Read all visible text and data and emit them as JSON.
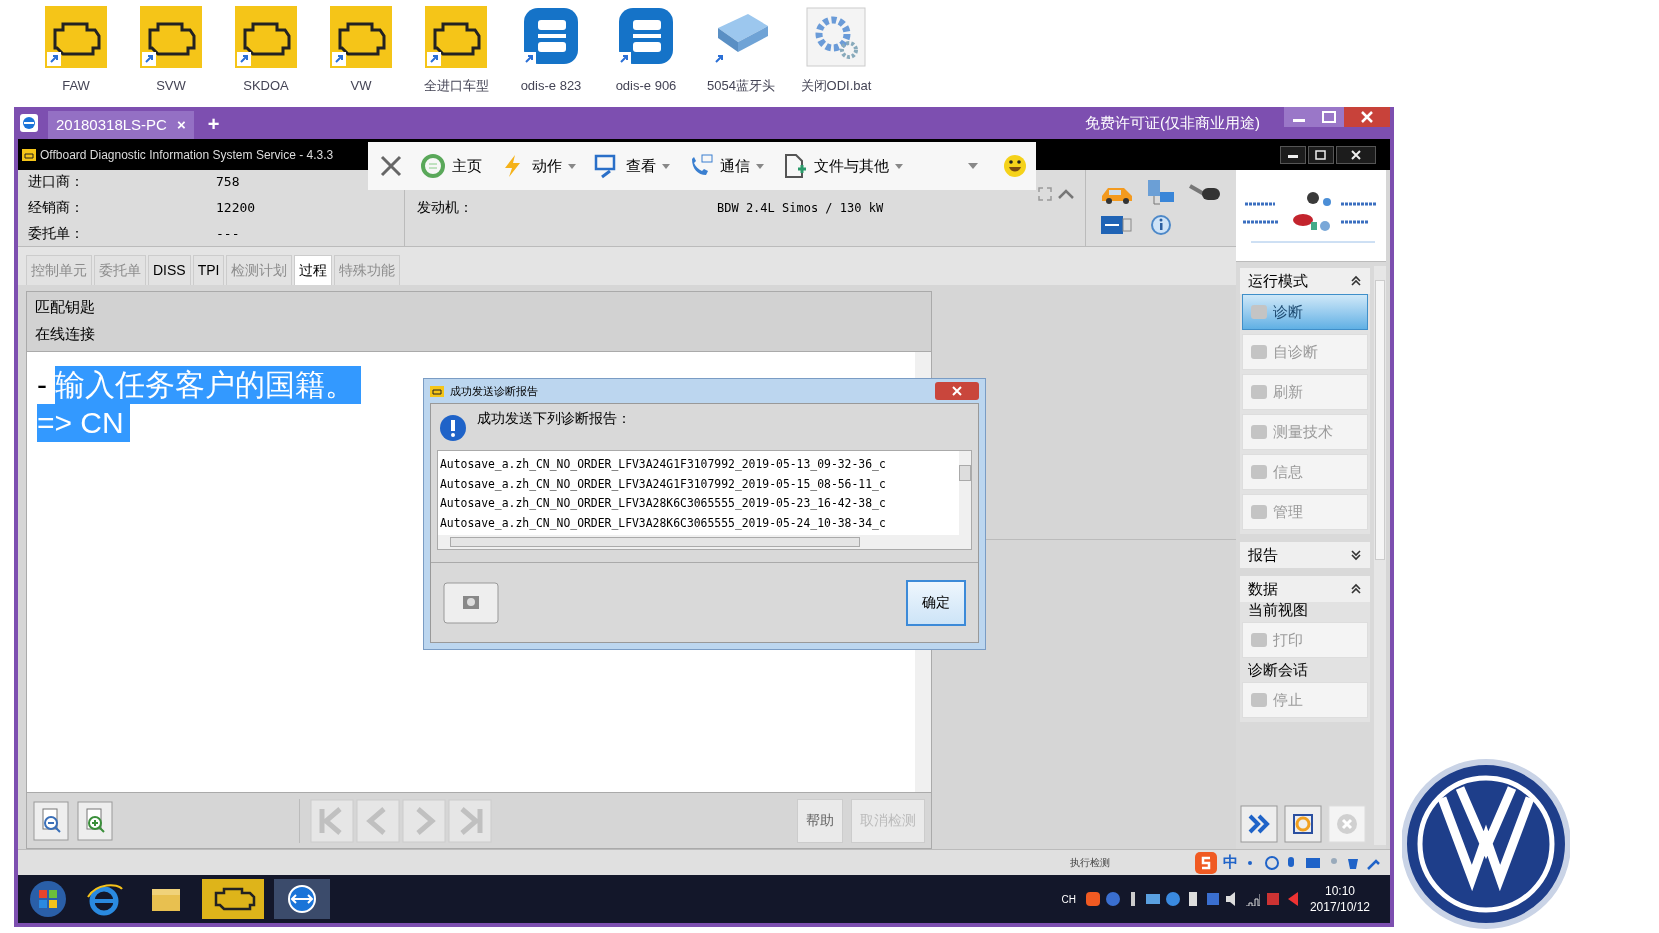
{
  "desktop_icons": [
    {
      "label": "FAW",
      "kind": "engine"
    },
    {
      "label": "SVW",
      "kind": "engine"
    },
    {
      "label": "SKDOA",
      "kind": "engine"
    },
    {
      "label": "VW",
      "kind": "engine"
    },
    {
      "label": "全进口车型",
      "kind": "engine"
    },
    {
      "label": "odis-e 823",
      "kind": "odis"
    },
    {
      "label": "odis-e 906",
      "kind": "odis"
    },
    {
      "label": "5054蓝牙头",
      "kind": "device"
    },
    {
      "label": "关闭ODI.bat",
      "kind": "gear"
    }
  ],
  "remote_window": {
    "tab": "20180318LS-PC",
    "tab_close": "×",
    "new_tab": "+",
    "license": "免费许可证(仅非商业用途)"
  },
  "app": {
    "title": "Offboard Diagnostic Information System Service - 4.3.3",
    "toolbar": [
      {
        "label": "主页",
        "kind": "home",
        "dropdown": false
      },
      {
        "label": "动作",
        "kind": "action",
        "dropdown": true
      },
      {
        "label": "查看",
        "kind": "view",
        "dropdown": true
      },
      {
        "label": "通信",
        "kind": "comm",
        "dropdown": true
      },
      {
        "label": "文件与其他",
        "kind": "file",
        "dropdown": true
      }
    ],
    "info_left": [
      {
        "label": "进口商：",
        "value": "758"
      },
      {
        "label": "经销商：",
        "value": "12200"
      },
      {
        "label": "委托单：",
        "value": "---"
      }
    ],
    "info_right": [
      {
        "label": "发动机：",
        "value": "BDW 2.4L Simos / 130 kW"
      }
    ],
    "tabs": [
      {
        "label": "控制单元",
        "disabled": true,
        "selected": false
      },
      {
        "label": "委托单",
        "disabled": true,
        "selected": false
      },
      {
        "label": "DISS",
        "disabled": false,
        "selected": false
      },
      {
        "label": "TPI",
        "disabled": false,
        "selected": false
      },
      {
        "label": "检测计划",
        "disabled": true,
        "selected": false
      },
      {
        "label": "过程",
        "disabled": false,
        "selected": true
      },
      {
        "label": "特殊功能",
        "disabled": true,
        "selected": false
      }
    ],
    "process": {
      "title": "匹配钥匙",
      "subtitle": "在线连接"
    },
    "instruction": {
      "bullet": "-",
      "lines": [
        "输入任务客户的国籍。",
        "=> CN"
      ],
      "selected": true
    },
    "bottom_buttons": [
      {
        "label": "帮助",
        "disabled": false
      },
      {
        "label": "取消检测",
        "disabled": true
      }
    ],
    "status": "执行检测",
    "side_sections": [
      {
        "title": "运行模式",
        "expanded": true,
        "groups": [
          {
            "items": [
              {
                "label": "诊断",
                "selected": true
              },
              {
                "label": "自诊断",
                "selected": false
              },
              {
                "label": "刷新",
                "selected": false
              },
              {
                "label": "测量技术",
                "selected": false
              },
              {
                "label": "信息",
                "selected": false
              },
              {
                "label": "管理",
                "selected": false
              }
            ]
          }
        ]
      },
      {
        "title": "报告",
        "expanded": false
      },
      {
        "title": "数据",
        "expanded": true,
        "groups": [
          {
            "title": "当前视图",
            "items": [
              {
                "label": "打印",
                "selected": false
              }
            ]
          },
          {
            "title": "诊断会话",
            "items": [
              {
                "label": "停止",
                "selected": false
              }
            ]
          }
        ]
      }
    ]
  },
  "dialog": {
    "title": "成功发送诊断报告",
    "message": "成功发送下列诊断报告：",
    "files": [
      "Autosave_a.zh_CN_NO_ORDER_LFV3A24G1F3107992_2019-05-13_09-32-36_c",
      "Autosave_a.zh_CN_NO_ORDER_LFV3A24G1F3107992_2019-05-15_08-56-11_c",
      "Autosave_a.zh_CN_NO_ORDER_LFV3A28K6C3065555_2019-05-23_16-42-38_c",
      "Autosave_a.zh_CN_NO_ORDER_LFV3A28K6C3065555_2019-05-24_10-38-34_c"
    ],
    "ok": "确定"
  },
  "ime": {
    "label": "中"
  },
  "taskbar": {
    "lang": "CH",
    "time": "10:10",
    "date": "2017/10/12"
  }
}
